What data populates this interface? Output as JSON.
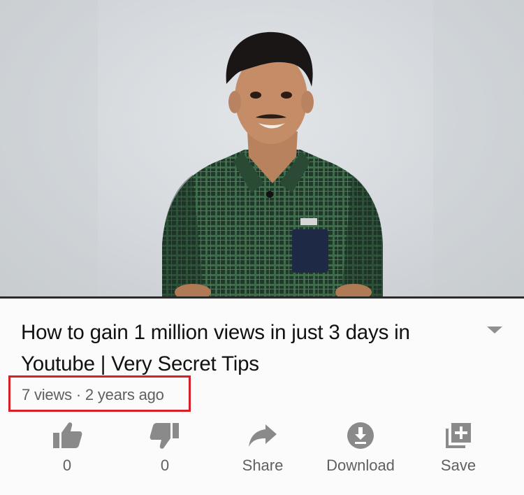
{
  "video": {
    "title": "How to gain 1 million views in just 3 days in Youtube | Very Secret Tips",
    "meta": "7 views · 2 years ago"
  },
  "actions": [
    {
      "icon": "thumbs-up-icon",
      "label": "0"
    },
    {
      "icon": "thumbs-down-icon",
      "label": "0"
    },
    {
      "icon": "share-icon",
      "label": "Share"
    },
    {
      "icon": "download-icon",
      "label": "Download"
    },
    {
      "icon": "save-playlist-icon",
      "label": "Save"
    }
  ],
  "colors": {
    "highlight_border": "#d61f26",
    "icon_gray": "#8a8a8a",
    "title_text": "#111111",
    "meta_text": "#606060"
  }
}
